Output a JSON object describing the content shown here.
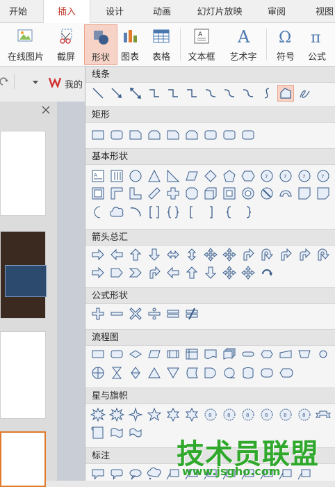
{
  "ribbon_tabs": [
    "开始",
    "插入",
    "设计",
    "动画",
    "幻灯片放映",
    "审阅",
    "视图"
  ],
  "tools": {
    "online_picture": "在线图片",
    "screenshot": "截屏",
    "shapes": "形状",
    "chart": "图表",
    "table": "表格",
    "textbox": "文本框",
    "wordart": "艺术字",
    "symbol": "符号",
    "formula": "公式"
  },
  "qbar": {
    "doc_label": "我的"
  },
  "panel": {
    "sections": {
      "lines": "线条",
      "rectangles": "矩形",
      "basic": "基本形状",
      "arrows": "箭头总汇",
      "equation": "公式形状",
      "flowchart": "流程图",
      "stars": "星与旗帜",
      "callouts": "标注"
    }
  },
  "watermark": {
    "text": "技术员联盟",
    "url": "www.jsgho.com"
  },
  "colors": {
    "accent": "#c0392b",
    "selected_bg": "#f6d3c6",
    "icon_stroke": "#3a5d8a"
  }
}
